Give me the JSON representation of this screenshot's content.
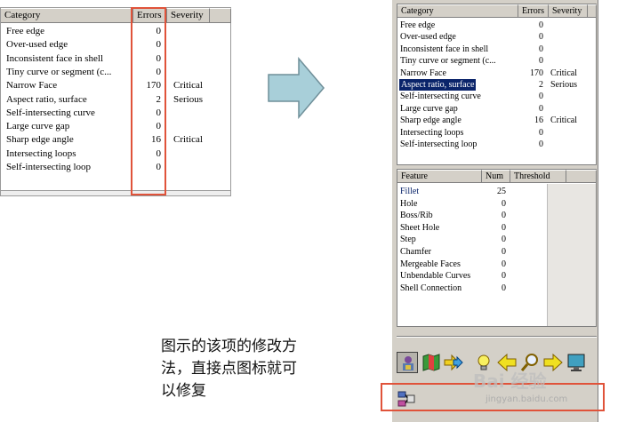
{
  "left_table": {
    "headers": {
      "category": "Category",
      "errors": "Errors",
      "severity": "Severity"
    },
    "rows": [
      {
        "category": "Free edge",
        "errors": "0",
        "severity": ""
      },
      {
        "category": "Over-used edge",
        "errors": "0",
        "severity": ""
      },
      {
        "category": "Inconsistent face in shell",
        "errors": "0",
        "severity": ""
      },
      {
        "category": "Tiny curve or segment (c...",
        "errors": "0",
        "severity": ""
      },
      {
        "category": "Narrow Face",
        "errors": "170",
        "severity": "Critical"
      },
      {
        "category": "Aspect ratio, surface",
        "errors": "2",
        "severity": "Serious"
      },
      {
        "category": "Self-intersecting curve",
        "errors": "0",
        "severity": ""
      },
      {
        "category": "Large curve gap",
        "errors": "0",
        "severity": ""
      },
      {
        "category": "Sharp edge angle",
        "errors": "16",
        "severity": "Critical"
      },
      {
        "category": "Intersecting loops",
        "errors": "0",
        "severity": ""
      },
      {
        "category": "Self-intersecting loop",
        "errors": "0",
        "severity": ""
      }
    ]
  },
  "right_table": {
    "headers": {
      "category": "Category",
      "errors": "Errors",
      "severity": "Severity"
    },
    "selected_index": 5,
    "rows": [
      {
        "category": "Free edge",
        "errors": "0",
        "severity": ""
      },
      {
        "category": "Over-used edge",
        "errors": "0",
        "severity": ""
      },
      {
        "category": "Inconsistent face in shell",
        "errors": "0",
        "severity": ""
      },
      {
        "category": "Tiny curve or segment (c...",
        "errors": "0",
        "severity": ""
      },
      {
        "category": "Narrow Face",
        "errors": "170",
        "severity": "Critical"
      },
      {
        "category": "Aspect ratio, surface",
        "errors": "2",
        "severity": "Serious"
      },
      {
        "category": "Self-intersecting curve",
        "errors": "0",
        "severity": ""
      },
      {
        "category": "Large curve gap",
        "errors": "0",
        "severity": ""
      },
      {
        "category": "Sharp edge angle",
        "errors": "16",
        "severity": "Critical"
      },
      {
        "category": "Intersecting loops",
        "errors": "0",
        "severity": ""
      },
      {
        "category": "Self-intersecting loop",
        "errors": "0",
        "severity": ""
      }
    ]
  },
  "feature_table": {
    "headers": {
      "feature": "Feature",
      "num": "Num",
      "threshold": "Threshold"
    },
    "rows": [
      {
        "feature": "Fillet",
        "num": "25"
      },
      {
        "feature": "Hole",
        "num": "0"
      },
      {
        "feature": "Boss/Rib",
        "num": "0"
      },
      {
        "feature": "Sheet Hole",
        "num": "0"
      },
      {
        "feature": "Step",
        "num": "0"
      },
      {
        "feature": "Chamfer",
        "num": "0"
      },
      {
        "feature": "Mergeable Faces",
        "num": "0"
      },
      {
        "feature": "Unbendable Curves",
        "num": "0"
      },
      {
        "feature": "Shell Connection",
        "num": "0"
      }
    ]
  },
  "toolbar": {
    "icons": [
      "person-lock-icon",
      "book-map-icon",
      "arrow-double-icon",
      "lightbulb-icon",
      "arrow-left-icon",
      "magnifier-icon",
      "arrow-right-icon",
      "monitor-icon"
    ],
    "fix_icon": "repair-tool-icon"
  },
  "annotation": {
    "line1": "图示的该项的修改方",
    "line2": "法，直接点图标就可",
    "line3": "以修复"
  },
  "watermark": {
    "brand": "Bai 经验",
    "url": "jingyan.baidu.com"
  },
  "colors": {
    "highlight_box": "#e0533a",
    "selection_bg": "#0a246a",
    "panel_bg": "#d4d0c8",
    "arrow_fill": "#a8cfd9"
  }
}
